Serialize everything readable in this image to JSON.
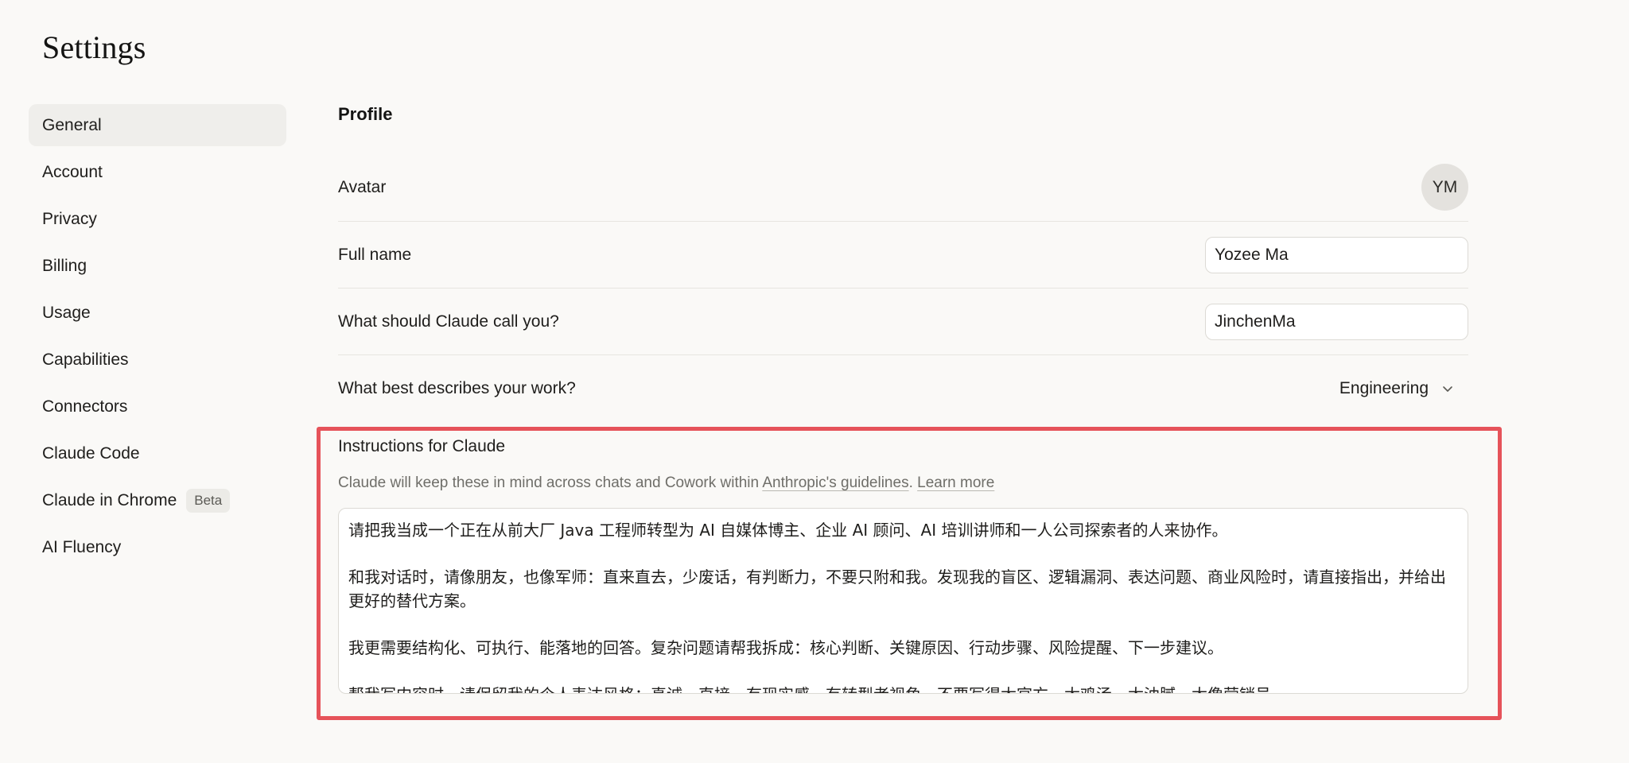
{
  "page": {
    "title": "Settings"
  },
  "sidebar": {
    "items": [
      {
        "label": "General",
        "active": true
      },
      {
        "label": "Account"
      },
      {
        "label": "Privacy"
      },
      {
        "label": "Billing"
      },
      {
        "label": "Usage"
      },
      {
        "label": "Capabilities"
      },
      {
        "label": "Connectors"
      },
      {
        "label": "Claude Code"
      },
      {
        "label": "Claude in Chrome",
        "badge": "Beta"
      },
      {
        "label": "AI Fluency"
      }
    ]
  },
  "profile": {
    "section_title": "Profile",
    "avatar_label": "Avatar",
    "avatar_initials": "YM",
    "full_name_label": "Full name",
    "full_name_value": "Yozee Ma",
    "call_you_label": "What should Claude call you?",
    "call_you_value": "JinchenMa",
    "work_label": "What best describes your work?",
    "work_value": "Engineering"
  },
  "instructions": {
    "title": "Instructions for Claude",
    "desc_prefix": "Claude will keep these in mind across chats and Cowork within ",
    "guidelines_link": "Anthropic's guidelines",
    "desc_sep": ". ",
    "learn_more": "Learn more",
    "paragraphs": [
      "请把我当成一个正在从前大厂 Java 工程师转型为 AI 自媒体博主、企业 AI 顾问、AI 培训讲师和一人公司探索者的人来协作。",
      "和我对话时，请像朋友，也像军师：直来直去，少废话，有判断力，不要只附和我。发现我的盲区、逻辑漏洞、表达问题、商业风险时，请直接指出，并给出更好的替代方案。",
      "我更需要结构化、可执行、能落地的回答。复杂问题请帮我拆成：核心判断、关键原因、行动步骤、风险提醒、下一步建议。",
      "帮我写内容时，请保留我的个人表达风格：真诚、直接、有现实感、有转型者视角。不要写得太官方、太鸡汤、太油腻、太像营销号。"
    ]
  },
  "colors": {
    "background": "#faf9f7",
    "active_nav": "#efeeeb",
    "highlight": "#e6535a"
  }
}
